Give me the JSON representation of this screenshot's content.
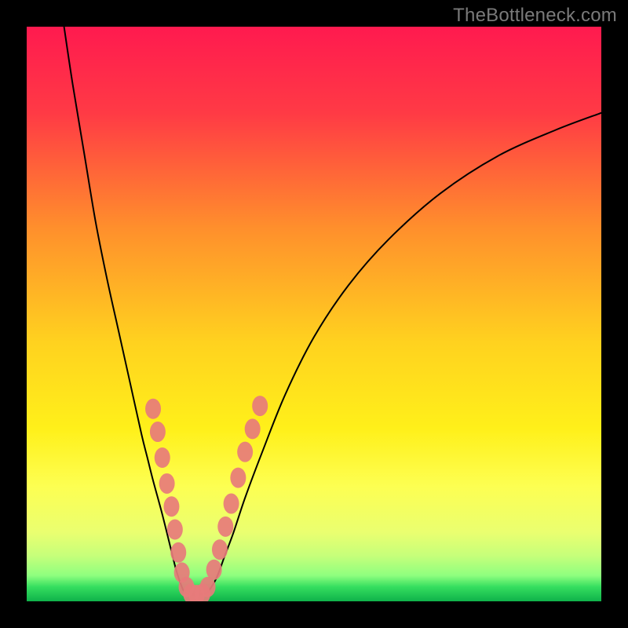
{
  "watermark": "TheBottleneck.com",
  "chart_data": {
    "type": "line",
    "title": "",
    "xlabel": "",
    "ylabel": "",
    "xlim": [
      0,
      100
    ],
    "ylim": [
      0,
      100
    ],
    "grid": false,
    "background_gradient": {
      "stops": [
        {
          "pos": 0.0,
          "color": "#ff1a4f"
        },
        {
          "pos": 0.15,
          "color": "#ff3a45"
        },
        {
          "pos": 0.35,
          "color": "#ff8f2c"
        },
        {
          "pos": 0.55,
          "color": "#ffd21f"
        },
        {
          "pos": 0.7,
          "color": "#fff01a"
        },
        {
          "pos": 0.8,
          "color": "#fdff52"
        },
        {
          "pos": 0.88,
          "color": "#eaff70"
        },
        {
          "pos": 0.92,
          "color": "#c7ff7a"
        },
        {
          "pos": 0.955,
          "color": "#8fff7f"
        },
        {
          "pos": 0.975,
          "color": "#35de5f"
        },
        {
          "pos": 1.0,
          "color": "#0fb24a"
        }
      ]
    },
    "series": [
      {
        "name": "left-branch",
        "type": "line",
        "x": [
          6.5,
          8,
          10,
          12,
          14,
          16,
          18,
          20,
          21,
          22,
          23.5,
          25,
          26,
          27,
          27.5
        ],
        "y": [
          100,
          90,
          78,
          66,
          56,
          47,
          38,
          29,
          25,
          21,
          15.5,
          9.5,
          5.5,
          2.5,
          1.5
        ]
      },
      {
        "name": "right-branch",
        "type": "line",
        "x": [
          31.5,
          33,
          34.5,
          36,
          38,
          41,
          45,
          50,
          56,
          63,
          72,
          82,
          92,
          100
        ],
        "y": [
          1.5,
          4,
          8,
          12,
          18,
          26,
          36,
          46,
          55,
          63,
          71,
          77.5,
          82,
          85
        ]
      },
      {
        "name": "valley-floor",
        "type": "line",
        "x": [
          27.5,
          29.5,
          31.5
        ],
        "y": [
          1.5,
          1.1,
          1.5
        ]
      }
    ],
    "markers": {
      "name": "data-points",
      "color": "#e77b7b",
      "points": [
        {
          "x": 22.0,
          "y": 33.5
        },
        {
          "x": 22.8,
          "y": 29.5
        },
        {
          "x": 23.6,
          "y": 25.0
        },
        {
          "x": 24.4,
          "y": 20.5
        },
        {
          "x": 25.2,
          "y": 16.5
        },
        {
          "x": 25.8,
          "y": 12.5
        },
        {
          "x": 26.4,
          "y": 8.5
        },
        {
          "x": 27.0,
          "y": 5.0
        },
        {
          "x": 27.8,
          "y": 2.5
        },
        {
          "x": 28.6,
          "y": 1.3
        },
        {
          "x": 29.6,
          "y": 1.1
        },
        {
          "x": 30.6,
          "y": 1.3
        },
        {
          "x": 31.5,
          "y": 2.5
        },
        {
          "x": 32.6,
          "y": 5.5
        },
        {
          "x": 33.6,
          "y": 9.0
        },
        {
          "x": 34.6,
          "y": 13.0
        },
        {
          "x": 35.6,
          "y": 17.0
        },
        {
          "x": 36.8,
          "y": 21.5
        },
        {
          "x": 38.0,
          "y": 26.0
        },
        {
          "x": 39.3,
          "y": 30.0
        },
        {
          "x": 40.6,
          "y": 34.0
        }
      ]
    }
  }
}
